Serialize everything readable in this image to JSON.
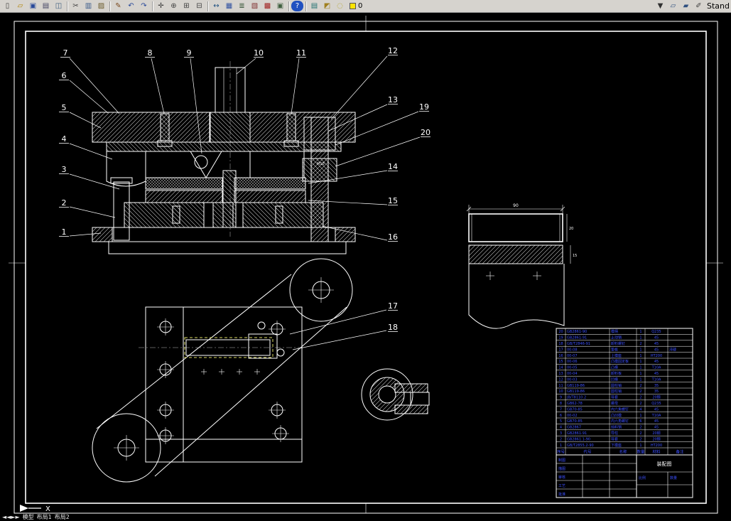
{
  "window": {
    "toolbar_right_label": "Stand"
  },
  "toolbar": {
    "layer_value": "0",
    "items": [
      {
        "t": "icon",
        "name": "new-icon",
        "g": "▯",
        "c": "#404040"
      },
      {
        "t": "icon",
        "name": "open-icon",
        "g": "▱",
        "c": "#b08000"
      },
      {
        "t": "icon",
        "name": "save-icon",
        "g": "▣",
        "c": "#2a4a9a"
      },
      {
        "t": "icon",
        "name": "print-icon",
        "g": "▤",
        "c": "#404060"
      },
      {
        "t": "icon",
        "name": "preview-icon",
        "g": "◫",
        "c": "#406080"
      },
      {
        "t": "sep"
      },
      {
        "t": "icon",
        "name": "cut-icon",
        "g": "✂",
        "c": "#404040"
      },
      {
        "t": "icon",
        "name": "copy-icon",
        "g": "▥",
        "c": "#3a5a8a"
      },
      {
        "t": "icon",
        "name": "paste-icon",
        "g": "▨",
        "c": "#6a5a2a"
      },
      {
        "t": "sep"
      },
      {
        "t": "icon",
        "name": "match-properties-icon",
        "g": "✎",
        "c": "#7a4a20"
      },
      {
        "t": "icon",
        "name": "undo-icon",
        "g": "↶",
        "c": "#2a4a9a"
      },
      {
        "t": "icon",
        "name": "redo-icon",
        "g": "↷",
        "c": "#2a4a9a"
      },
      {
        "t": "sep"
      },
      {
        "t": "icon",
        "name": "pan-icon",
        "g": "✛",
        "c": "#404040"
      },
      {
        "t": "icon",
        "name": "zoom-realtime-icon",
        "g": "⊕",
        "c": "#404040"
      },
      {
        "t": "icon",
        "name": "zoom-window-icon",
        "g": "⊞",
        "c": "#404040"
      },
      {
        "t": "icon",
        "name": "zoom-previous-icon",
        "g": "⊟",
        "c": "#404040"
      },
      {
        "t": "sep"
      },
      {
        "t": "icon",
        "name": "measure-icon",
        "g": "↔",
        "c": "#205080"
      },
      {
        "t": "icon",
        "name": "table-icon",
        "g": "▦",
        "c": "#3050a0"
      },
      {
        "t": "icon",
        "name": "layers-icon",
        "g": "≣",
        "c": "#305030"
      },
      {
        "t": "icon",
        "name": "properties-icon",
        "g": "▧",
        "c": "#803030"
      },
      {
        "t": "icon",
        "name": "block-icon",
        "g": "▩",
        "c": "#a02020"
      },
      {
        "t": "icon",
        "name": "named-views-icon",
        "g": "▣",
        "c": "#406040"
      },
      {
        "t": "sep"
      },
      {
        "t": "icon",
        "name": "help-icon",
        "g": "?",
        "c": "#ffffff",
        "bg": "#2050c0"
      },
      {
        "t": "sep"
      },
      {
        "t": "icon",
        "name": "sheet-set-icon",
        "g": "▤",
        "c": "#207070"
      },
      {
        "t": "icon",
        "name": "publish-icon",
        "g": "◩",
        "c": "#a08020"
      },
      {
        "t": "icon",
        "name": "lightbulb-icon",
        "g": "◌",
        "c": "#b0a020"
      },
      {
        "t": "layer"
      },
      {
        "t": "space"
      },
      {
        "t": "icon",
        "name": "toolbar-overflow-chevron",
        "g": "▼",
        "c": "#303030"
      },
      {
        "t": "icon",
        "name": "layout-sheet-icon",
        "g": "▱",
        "c": "#305080"
      },
      {
        "t": "icon",
        "name": "plot-style-icon",
        "g": "▰",
        "c": "#305080"
      },
      {
        "t": "icon",
        "name": "edit-pencil-icon",
        "g": "✐",
        "c": "#404040"
      },
      {
        "t": "label",
        "name": "toolbar-name-label"
      }
    ]
  },
  "callouts": {
    "list": [
      "7",
      "8",
      "9",
      "10",
      "11",
      "12",
      "6",
      "5",
      "4",
      "3",
      "2",
      "1",
      "13",
      "19",
      "20",
      "14",
      "15",
      "16",
      "17",
      "18"
    ]
  },
  "dims": {
    "detail_width": "90",
    "detail_h1": "20",
    "detail_h2": "15",
    "thread": "M10"
  },
  "parts_table": {
    "header": [
      "序号",
      "代号",
      "名称",
      "数量",
      "材料",
      "备注"
    ],
    "rows": [
      [
        "20",
        "GB2861-90",
        "模柄",
        "1",
        "Q235",
        ""
      ],
      [
        "19",
        "GB2861-91",
        "止动销",
        "1",
        "45",
        ""
      ],
      [
        "18",
        "GB/T2846-91",
        "卸料螺钉",
        "2",
        "45",
        ""
      ],
      [
        "17",
        "00-08",
        "垫板",
        "1",
        "45",
        "淬硬"
      ],
      [
        "16",
        "00-07",
        "上模座",
        "1",
        "HT200",
        ""
      ],
      [
        "15",
        "00-06",
        "凸模固定板",
        "1",
        "45",
        ""
      ],
      [
        "14",
        "00-05",
        "凸模",
        "1",
        "T10A",
        ""
      ],
      [
        "13",
        "00-04",
        "卸料板",
        "1",
        "45",
        ""
      ],
      [
        "12",
        "00-03",
        "凹模",
        "1",
        "T10A",
        ""
      ],
      [
        "11",
        "GB119-86",
        "圆柱销",
        "2",
        "35",
        ""
      ],
      [
        "10",
        "GB119-86",
        "圆柱销",
        "2",
        "35",
        ""
      ],
      [
        "9",
        "JB/T8110.2",
        "导套",
        "2",
        "20钢",
        ""
      ],
      [
        "8",
        "GB62-78",
        "螺母",
        "2",
        "Q235",
        ""
      ],
      [
        "7",
        "GB70-85",
        "内六角螺钉",
        "4",
        "45",
        ""
      ],
      [
        "6",
        "00-02",
        "凸凹模",
        "1",
        "T10A",
        ""
      ],
      [
        "5",
        "GB70-85",
        "内六角螺钉",
        "6",
        "45",
        ""
      ],
      [
        "4",
        "GB2867",
        "挡料销",
        "2",
        "45",
        ""
      ],
      [
        "3",
        "GB2861-91",
        "导柱",
        "2",
        "20钢",
        ""
      ],
      [
        "2",
        "GB2861.1-90",
        "导套",
        "2",
        "20钢",
        ""
      ],
      [
        "1",
        "GB/T2855.2-90",
        "下模座",
        "1",
        "HT200",
        ""
      ]
    ]
  },
  "title_area": {
    "labels": [
      "制图",
      "描图",
      "审核",
      "工艺",
      "批准"
    ],
    "drawing_name": "装配图",
    "scale_label": "比例",
    "qty_label": "数量"
  },
  "tabs": {
    "nav": "◄◄►►",
    "model": "模型",
    "layout1": "布局1",
    "layout2": "布局2"
  },
  "ucs": {
    "x_label": "X"
  }
}
